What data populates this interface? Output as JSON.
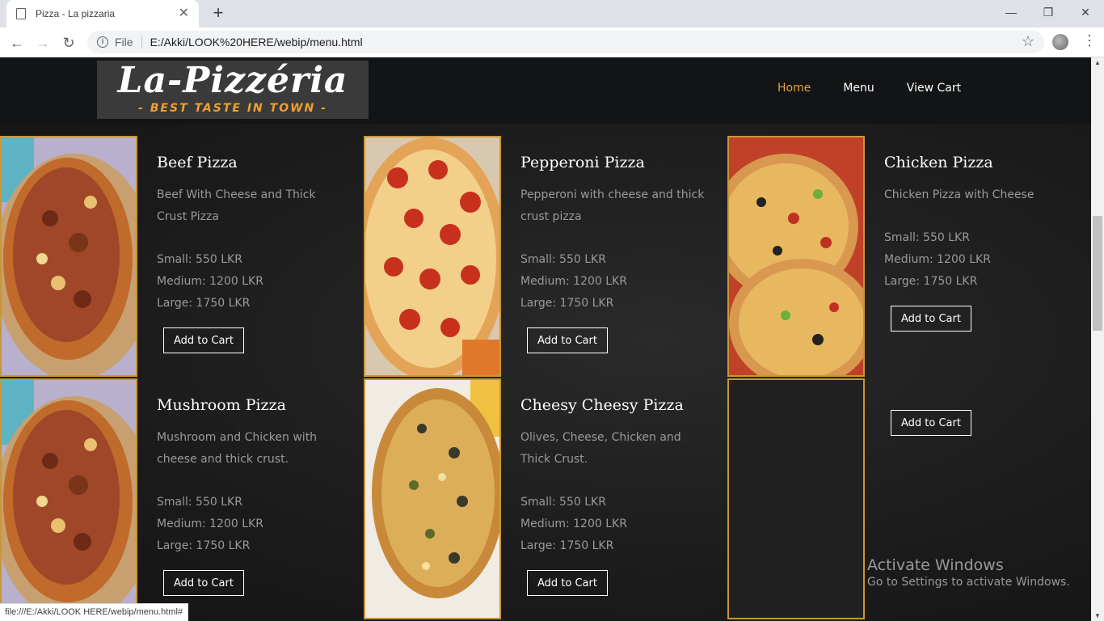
{
  "browser": {
    "tab_title": "Pizza - La pizzaria",
    "url_scheme": "File",
    "url": "E:/Akki/LOOK%20HERE/webip/menu.html",
    "status_url": "file:///E:/Akki/LOOK HERE/webip/menu.html#"
  },
  "site": {
    "logo_main": "La-Pizzéria",
    "logo_tagline": "- BEST TASTE IN TOWN -",
    "nav": [
      "Home",
      "Menu",
      "View Cart"
    ],
    "accent_color": "#e8a33c"
  },
  "menu": {
    "items": [
      {
        "title": "Beef Pizza",
        "desc": "Beef With Cheese and Thick Crust Pizza",
        "prices": [
          "Small: 550 LKR",
          "Medium: 1200 LKR",
          "Large: 1750 LKR"
        ],
        "button": "Add to Cart"
      },
      {
        "title": "Pepperoni Pizza",
        "desc": "Pepperoni with cheese and thick crust pizza",
        "prices": [
          "Small: 550 LKR",
          "Medium: 1200 LKR",
          "Large: 1750 LKR"
        ],
        "button": "Add to Cart"
      },
      {
        "title": "Chicken Pizza",
        "desc": "Chicken Pizza with Cheese",
        "prices": [
          "Small: 550 LKR",
          "Medium: 1200 LKR",
          "Large: 1750 LKR"
        ],
        "button": "Add to Cart"
      },
      {
        "title": "Mushroom Pizza",
        "desc": "Mushroom and Chicken with cheese and thick crust.",
        "prices": [
          "Small: 550 LKR",
          "Medium: 1200 LKR",
          "Large: 1750 LKR"
        ],
        "button": "Add to Cart"
      },
      {
        "title": "Cheesy Cheesy Pizza",
        "desc": "Olives, Cheese, Chicken and Thick Crust.",
        "prices": [
          "Small: 550 LKR",
          "Medium: 1200 LKR",
          "Large: 1750 LKR"
        ],
        "button": "Add to Cart"
      },
      {
        "button": "Add to Cart"
      }
    ]
  },
  "watermark": {
    "line1": "Activate Windows",
    "line2": "Go to Settings to activate Windows."
  }
}
